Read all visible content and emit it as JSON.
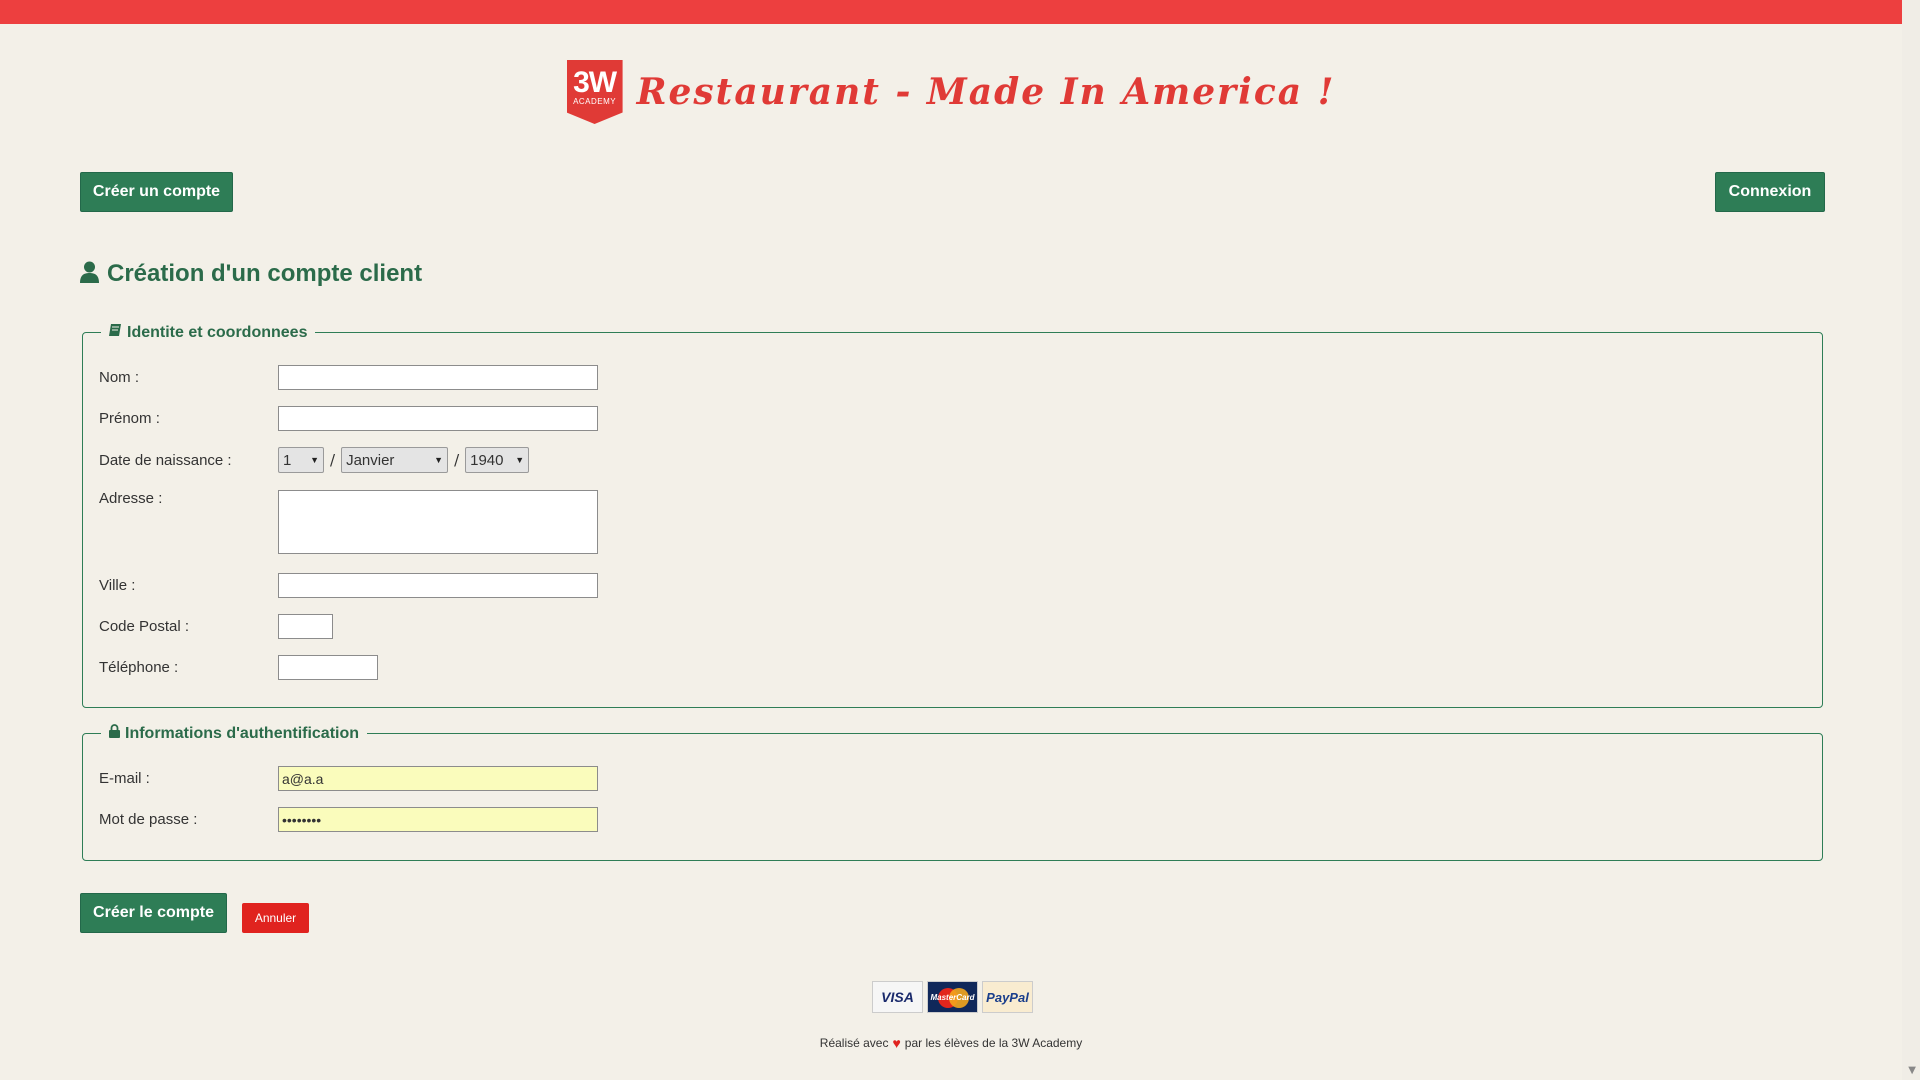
{
  "header": {
    "logo_main": "3W",
    "logo_sub": "ACADEMY",
    "title": "Restaurant - Made In America !"
  },
  "nav": {
    "create_account_label": "Créer un compte",
    "login_label": "Connexion"
  },
  "page": {
    "heading": "Création d'un compte client"
  },
  "identity_section": {
    "legend": "Identite et coordonnees",
    "fields": {
      "nom_label": "Nom :",
      "nom_value": "",
      "prenom_label": "Prénom :",
      "prenom_value": "",
      "birth_label": "Date de naissance :",
      "birth_day": "1",
      "birth_month": "Janvier",
      "birth_year": "1940",
      "birth_separator": "/",
      "adresse_label": "Adresse :",
      "adresse_value": "",
      "ville_label": "Ville :",
      "ville_value": "",
      "code_postal_label": "Code Postal :",
      "code_postal_value": "",
      "telephone_label": "Téléphone :",
      "telephone_value": ""
    }
  },
  "auth_section": {
    "legend": "Informations d'authentification",
    "fields": {
      "email_label": "E-mail :",
      "email_value": "a@a.a",
      "password_label": "Mot de passe :",
      "password_value": "••••••••"
    }
  },
  "actions": {
    "submit_label": "Créer le compte",
    "cancel_label": "Annuler"
  },
  "payments": {
    "visa": "VISA",
    "mastercard": "MasterCard",
    "paypal": "PayPal"
  },
  "footer": {
    "text_before": "Réalisé avec",
    "text_after": "par les élèves de la 3W Academy"
  },
  "colors": {
    "accent_red": "#ed3f3f",
    "primary_green": "#2e7d56",
    "background": "#f3f0e8",
    "autofill_yellow": "#fafcbc"
  }
}
